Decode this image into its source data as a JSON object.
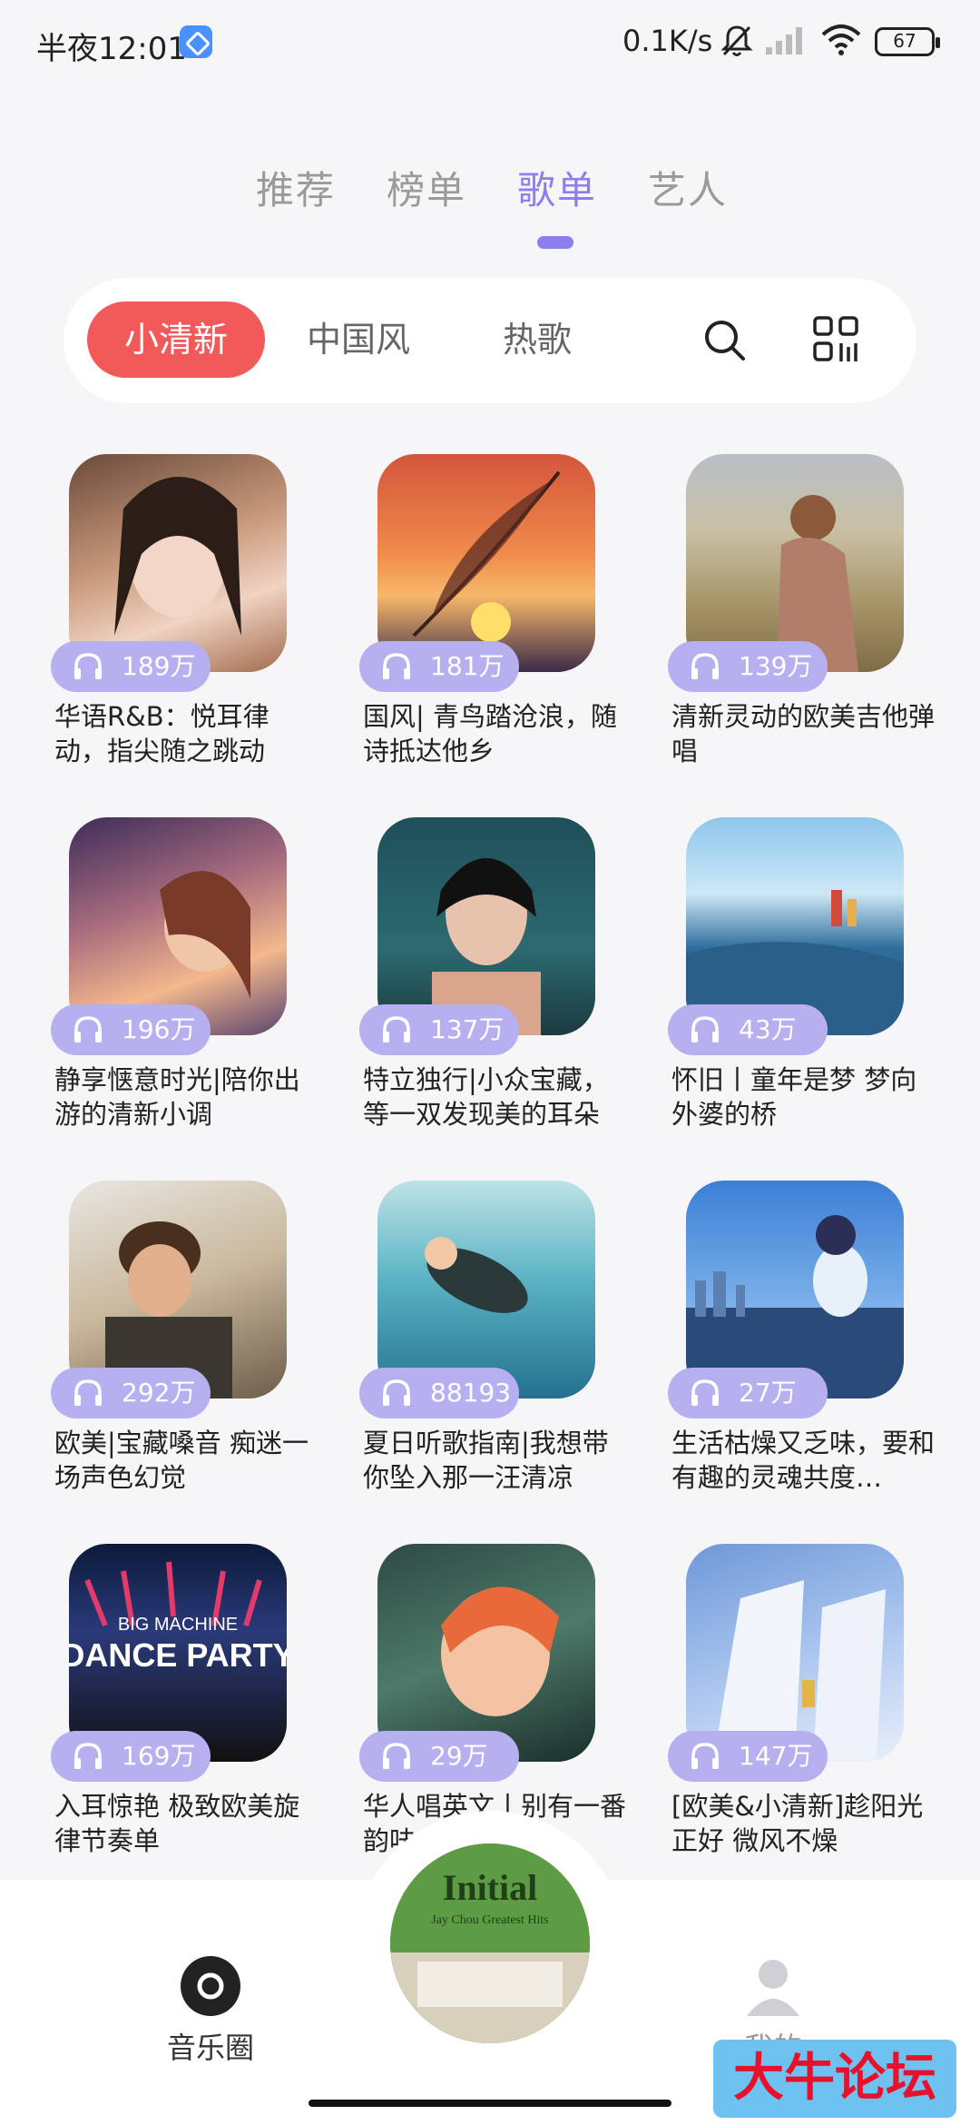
{
  "status": {
    "time": "半夜12:01",
    "speed": "0.1K/s",
    "battery": "67"
  },
  "tabs": [
    "推荐",
    "榜单",
    "歌单",
    "艺人"
  ],
  "active_tab": "歌单",
  "filters": {
    "chips": [
      "小清新",
      "中国风",
      "热歌"
    ],
    "active": "小清新"
  },
  "playlists": [
    {
      "plays": "189万",
      "title": "华语R&B：悦耳律动，指尖随之跳动"
    },
    {
      "plays": "181万",
      "title": "国风| 青鸟踏沧浪，随诗抵达他乡"
    },
    {
      "plays": "139万",
      "title": "清新灵动的欧美吉他弹唱"
    },
    {
      "plays": "196万",
      "title": "静享惬意时光|陪你出游的清新小调"
    },
    {
      "plays": "137万",
      "title": "特立独行|小众宝藏，等一双发现美的耳朵"
    },
    {
      "plays": "43万",
      "title": "怀旧丨童年是梦 梦向外婆的桥"
    },
    {
      "plays": "292万",
      "title": "欧美|宝藏嗓音 痴迷一场声色幻觉"
    },
    {
      "plays": "88193",
      "title": "夏日听歌指南|我想带你坠入那一汪清凉"
    },
    {
      "plays": "27万",
      "title": "生活枯燥又乏味，要和有趣的灵魂共度…"
    },
    {
      "plays": "169万",
      "title": "入耳惊艳 极致欧美旋律节奏单"
    },
    {
      "plays": "29万",
      "title": "华人唱英文丨别有一番韵味"
    },
    {
      "plays": "147万",
      "title": "[欧美&小清新]趁阳光正好 微风不燥"
    }
  ],
  "cover_texts": {
    "dance_line1": "BIG MACHINE",
    "dance_line2": "DANCE PARTY"
  },
  "bottom_nav": {
    "left": "音乐圈",
    "right": "我的"
  },
  "now_playing": {
    "album_title": "Initial",
    "album_subtitle": "Jay Chou Greatest Hits"
  },
  "watermark": "大牛论坛"
}
